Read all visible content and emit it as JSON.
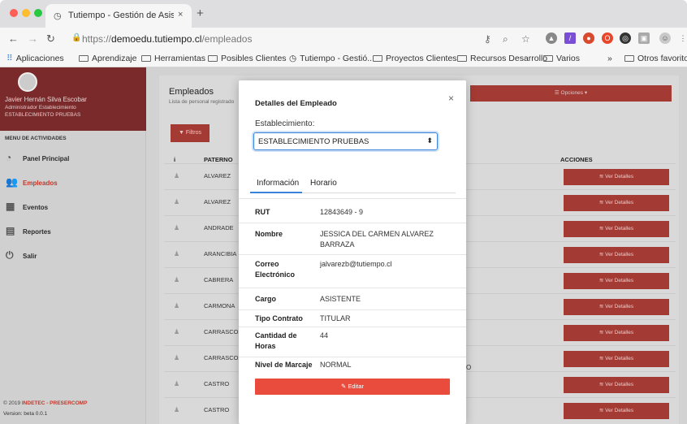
{
  "browser": {
    "tab_title": "Tutiempo - Gestión de Asistencia",
    "tab_close": "×",
    "new_tab": "+",
    "url_scheme": "https://",
    "url_host": "demoedu.tutiempo.cl",
    "url_path": "/empleados",
    "bookmarks": [
      "Aplicaciones",
      "Aprendizaje",
      "Herramientas",
      "Posibles Clientes",
      "Tutiempo - Gestió...",
      "Proyectos Clientes",
      "Recursos Desarrollo",
      "Varios",
      "»",
      "Otros favoritos"
    ]
  },
  "sidebar": {
    "user_name": "Javier Hernán Silva Escobar",
    "user_role": "Administrador Establecimiento",
    "user_establishment": "ESTABLECIMIENTO PRUEBAS",
    "menu_header": "MENU DE ACTIVIDADES",
    "items": [
      {
        "label": "Panel Principal",
        "icon": "dashboard-icon"
      },
      {
        "label": "Empleados",
        "icon": "users-icon"
      },
      {
        "label": "Eventos",
        "icon": "calendar-icon"
      },
      {
        "label": "Reportes",
        "icon": "file-icon"
      },
      {
        "label": "Salir",
        "icon": "power-icon"
      }
    ],
    "copyright_prefix": "© 2019 ",
    "copyright_brand": "INDETEC - PRESERCOMP",
    "version": "Version: beta 0.0.1"
  },
  "content": {
    "title": "Empleados",
    "subtitle": "Lista de personal registrado",
    "options_label": "Opciones",
    "filter_label": "Filtros",
    "col_info": "i",
    "col_paterno": "PATERNO",
    "col_acciones": "ACCIONES",
    "rows": [
      "ALVAREZ",
      "ALVAREZ",
      "ANDRADE",
      "ARANCIBIA",
      "CABRERA",
      "CARMONA",
      "CARRASCO",
      "CARRASCO",
      "CASTRO",
      "CASTRO"
    ],
    "row_button": "Ver Detalles",
    "stub_text": "O"
  },
  "modal": {
    "title": "Detalles del Empleado",
    "close": "×",
    "establishment_label": "Establecimiento:",
    "establishment_value": "ESTABLECIMIENTO PRUEBAS",
    "tab_info": "Información",
    "tab_schedule": "Horario",
    "fields": [
      {
        "key": "RUT",
        "value": "12843649 - 9"
      },
      {
        "key": "Nombre",
        "value": "JESSICA DEL CARMEN ALVAREZ BARRAZA"
      },
      {
        "key": "Correo Electrónico",
        "value": "jalvarezb@tutiempo.cl"
      },
      {
        "key": "Cargo",
        "value": "ASISTENTE"
      },
      {
        "key": "Tipo Contrato",
        "value": "TITULAR"
      },
      {
        "key": "Cantidad de Horas",
        "value": "44"
      },
      {
        "key": "Nivel de Marcaje",
        "value": "NORMAL"
      }
    ],
    "edit_button": "Editar"
  }
}
